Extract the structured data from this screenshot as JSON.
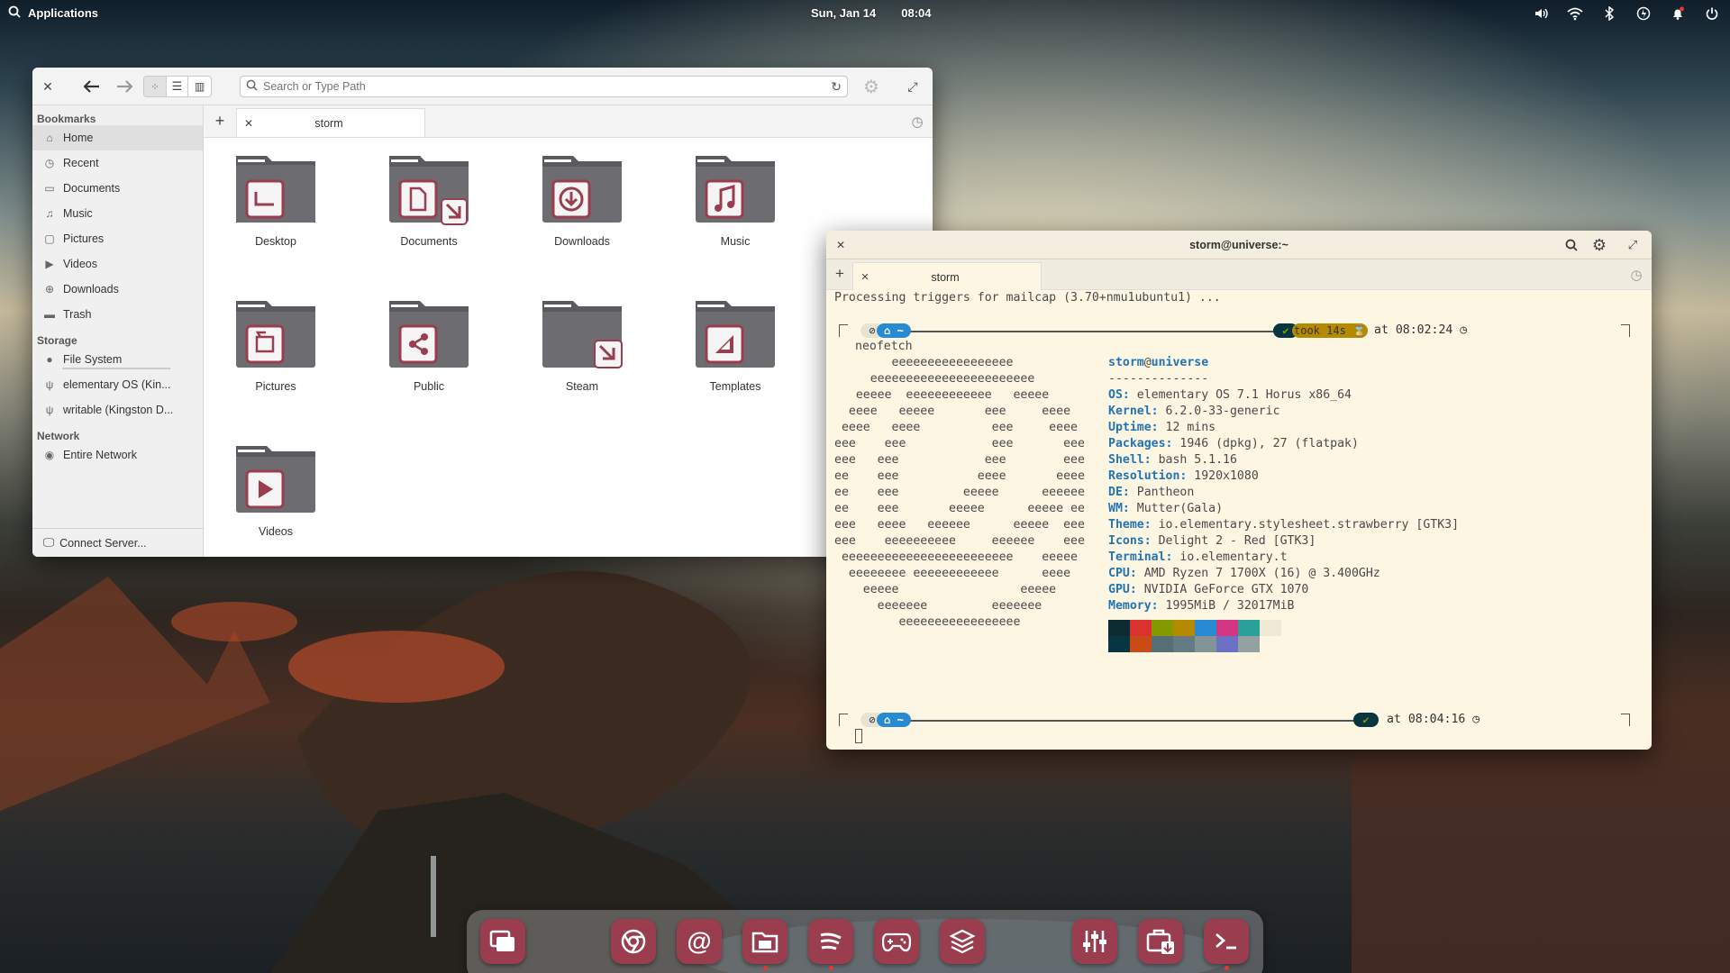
{
  "panel": {
    "applications": "Applications",
    "date": "Sun, Jan 14",
    "time": "08:04"
  },
  "file_manager": {
    "search_placeholder": "Search or Type Path",
    "tab": "storm",
    "sidebar": {
      "bookmarks_header": "Bookmarks",
      "bookmarks": [
        {
          "label": "Home",
          "icon": "home-icon"
        },
        {
          "label": "Recent",
          "icon": "recent-icon"
        },
        {
          "label": "Documents",
          "icon": "documents-icon"
        },
        {
          "label": "Music",
          "icon": "music-icon"
        },
        {
          "label": "Pictures",
          "icon": "pictures-icon"
        },
        {
          "label": "Videos",
          "icon": "videos-icon"
        },
        {
          "label": "Downloads",
          "icon": "downloads-icon"
        },
        {
          "label": "Trash",
          "icon": "trash-icon"
        }
      ],
      "storage_header": "Storage",
      "storage": [
        {
          "label": "File System",
          "icon": "drive-icon"
        },
        {
          "label": "elementary OS (Kin...",
          "icon": "usb-icon"
        },
        {
          "label": "writable (Kingston D...",
          "icon": "usb-icon"
        }
      ],
      "network_header": "Network",
      "network": [
        {
          "label": "Entire Network",
          "icon": "network-icon"
        }
      ],
      "connect_server": "Connect Server..."
    },
    "folders": [
      {
        "label": "Desktop",
        "icon": "desktop-icon"
      },
      {
        "label": "Documents",
        "icon": "document-icon"
      },
      {
        "label": "Downloads",
        "icon": "download-icon"
      },
      {
        "label": "Music",
        "icon": "music-note-icon"
      },
      {
        "label": "Pictures",
        "icon": "picture-icon"
      },
      {
        "label": "Public",
        "icon": "share-icon"
      },
      {
        "label": "Steam",
        "icon": "link-icon"
      },
      {
        "label": "Templates",
        "icon": "template-icon"
      },
      {
        "label": "Videos",
        "icon": "play-icon"
      }
    ]
  },
  "terminal": {
    "title": "storm@universe:~",
    "tab": "storm",
    "first_line": "Processing triggers for mailcap (3.70+nmu1ubuntu1) ...",
    "prompt1": {
      "home": "~",
      "took": "took 14s",
      "at": "at 08:02:24"
    },
    "command": "neofetch",
    "logo": [
      "        eeeeeeeeeeeeeeeee",
      "     eeeeeeeeeeeeeeeeeeeeeee",
      "   eeeee  eeeeeeeeeeee   eeeee",
      "  eeee   eeeee       eee     eeee",
      " eeee   eeee          eee     eeee",
      "eee    eee            eee       eee",
      "eee   eee            eee        eee",
      "ee    eee           eeee       eeee",
      "ee    eee         eeeee      eeeeee",
      "ee    eee       eeeee      eeeee ee",
      "eee   eeee   eeeeee      eeeee  eee",
      "eee    eeeeeeeeee     eeeeee    eee",
      " eeeeeeeeeeeeeeeeeeeeeeee    eeeee",
      "  eeeeeeee eeeeeeeeeeee      eeee",
      "    eeeee                 eeeee",
      "      eeeeeee         eeeeeee",
      "         eeeeeeeeeeeeeeeee"
    ],
    "user": "storm",
    "host": "universe",
    "separator": "--------------",
    "info": [
      {
        "k": "OS",
        "v": "elementary OS 7.1 Horus x86_64"
      },
      {
        "k": "Kernel",
        "v": "6.2.0-33-generic"
      },
      {
        "k": "Uptime",
        "v": "12 mins"
      },
      {
        "k": "Packages",
        "v": "1946 (dpkg), 27 (flatpak)"
      },
      {
        "k": "Shell",
        "v": "bash 5.1.16"
      },
      {
        "k": "Resolution",
        "v": "1920x1080"
      },
      {
        "k": "DE",
        "v": "Pantheon"
      },
      {
        "k": "WM",
        "v": "Mutter(Gala)"
      },
      {
        "k": "Theme",
        "v": "io.elementary.stylesheet.strawberry [GTK3]"
      },
      {
        "k": "Icons",
        "v": "Delight 2 - Red [GTK3]"
      },
      {
        "k": "Terminal",
        "v": "io.elementary.t"
      },
      {
        "k": "CPU",
        "v": "AMD Ryzen 7 1700X (16) @ 3.400GHz"
      },
      {
        "k": "GPU",
        "v": "NVIDIA GeForce GTX 1070"
      },
      {
        "k": "Memory",
        "v": "1995MiB / 32017MiB"
      }
    ],
    "palette_top": [
      "#0b2b30",
      "#dc322f",
      "#859900",
      "#b58900",
      "#268bd2",
      "#d33682",
      "#2aa198",
      "#eee8d5"
    ],
    "palette_bottom": [
      "#073642",
      "#cb4b16",
      "#586e75",
      "#657b83",
      "#839496",
      "#6c71c4",
      "#93a1a1",
      "#fdf6e3"
    ],
    "prompt2": {
      "home": "~",
      "at": "at 08:04:16"
    }
  },
  "dock": {
    "items": [
      "multitasking-icon",
      "browser-icon",
      "mail-icon",
      "files-icon",
      "music-player-icon",
      "games-icon",
      "app-center-icon",
      "settings-icon",
      "installer-icon",
      "terminal-icon"
    ]
  },
  "colors": {
    "accent": "#9a3d4f",
    "terminal_bg": "#fdf6e3",
    "prompt_blue": "#268bd2",
    "prompt_dark": "#073642",
    "prompt_yellow": "#b58900"
  }
}
